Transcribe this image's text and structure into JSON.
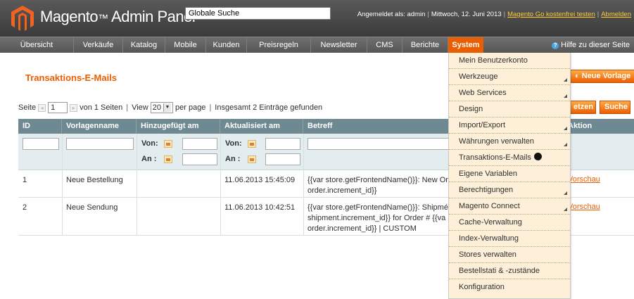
{
  "header": {
    "brand": "Magento",
    "brand_suffix": "Admin Panel",
    "search_value": "Globale Suche",
    "logged_in": "Angemeldet als: admin",
    "date": "Mittwoch, 12. Juni 2013",
    "go_link": "Magento Go kostenfrei testen",
    "logout": "Abmelden"
  },
  "nav": {
    "items": [
      "Übersicht",
      "Verkäufe",
      "Katalog",
      "Mobile",
      "Kunden",
      "Preisregeln",
      "Newsletter",
      "CMS",
      "Berichte",
      "System"
    ],
    "active": "System",
    "help": "Hilfe zu dieser Seite"
  },
  "page": {
    "title": "Transaktions-E-Mails",
    "new_template_button": "Neue Vorlage",
    "reset_button": "etzen",
    "search_button": "Suche"
  },
  "pager": {
    "page_label": "Seite",
    "page_value": "1",
    "of_pages": "von 1 Seiten",
    "view_label": "View",
    "per_page_value": "20",
    "per_page_label": "per page",
    "total": "Insgesamt 2 Einträge gefunden",
    "sep": "|"
  },
  "grid": {
    "columns": [
      "ID",
      "Vorlagenname",
      "Hinzugefügt am",
      "Aktualisiert am",
      "Betreff",
      "Aktion"
    ],
    "from_label": "Von:",
    "to_label": "An :",
    "rows": [
      {
        "id": "1",
        "name": "Neue Bestellung",
        "added": "",
        "updated": "11.06.2013 15:45:09",
        "subject_1": "{{var store.getFrontendName()}}: New Or",
        "subject_2": "order.increment_id}}",
        "subject_3": "",
        "action": "Vorschau"
      },
      {
        "id": "2",
        "name": "Neue Sendung",
        "added": "",
        "updated": "11.06.2013 10:42:51",
        "subject_1": "{{var store.getFrontendName()}}: Shipmé",
        "subject_2": "shipment.increment_id}} for Order # {{va",
        "subject_3": "order.increment_id}} | CUSTOM",
        "action": "Vorschau"
      }
    ]
  },
  "system_menu": {
    "items": [
      {
        "label": "Mein Benutzerkonto",
        "submenu": false
      },
      {
        "label": "Werkzeuge",
        "submenu": true
      },
      {
        "label": "Web Services",
        "submenu": true
      },
      {
        "label": "Design",
        "submenu": false
      },
      {
        "label": "Import/Export",
        "submenu": true
      },
      {
        "label": "Währungen verwalten",
        "submenu": true
      },
      {
        "label": "Transaktions-E-Mails",
        "submenu": false
      },
      {
        "label": "Eigene Variablen",
        "submenu": false
      },
      {
        "label": "Berechtigungen",
        "submenu": true
      },
      {
        "label": "Magento Connect",
        "submenu": true
      },
      {
        "label": "Cache-Verwaltung",
        "submenu": false
      },
      {
        "label": "Index-Verwaltung",
        "submenu": false
      },
      {
        "label": "Stores verwalten",
        "submenu": false
      },
      {
        "label": "Bestellstati & -zustände",
        "submenu": false
      },
      {
        "label": "Konfiguration",
        "submenu": false
      }
    ]
  },
  "colors": {
    "accent": "#eb5e00",
    "header": "#4a4a4a",
    "grid_header": "#6f8992",
    "menu_bg": "#fef0d8"
  }
}
